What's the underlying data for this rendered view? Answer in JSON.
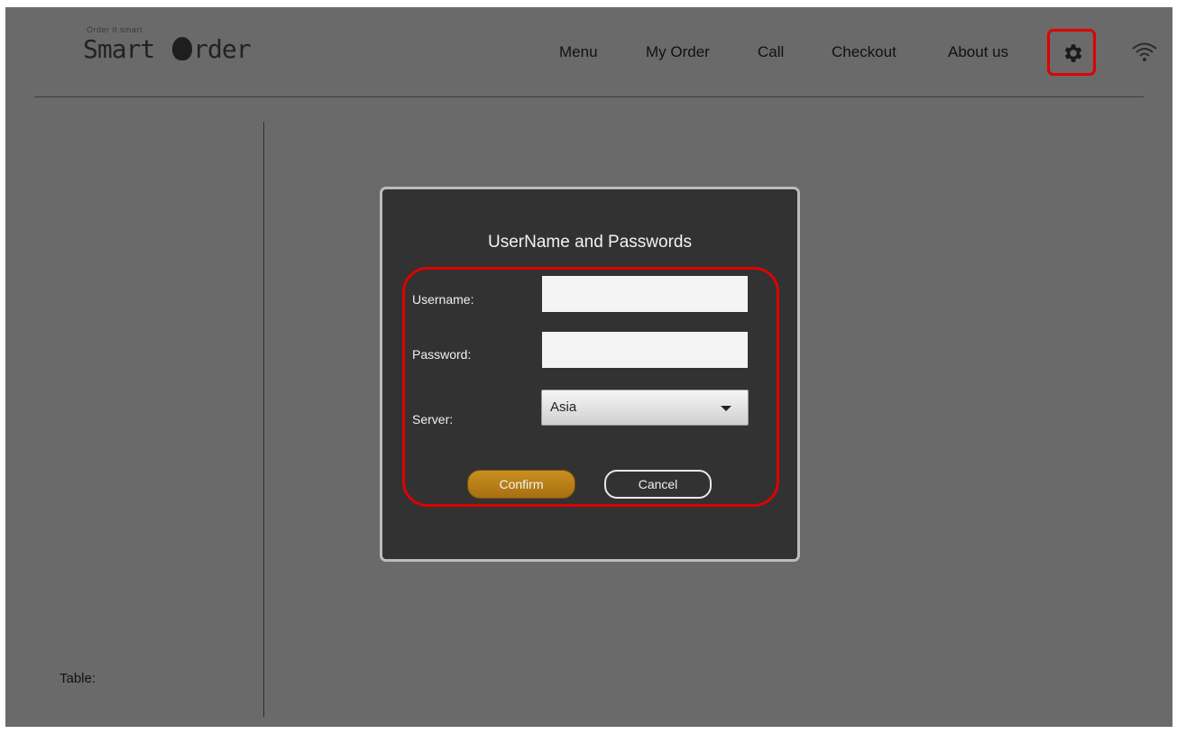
{
  "app": {
    "tagline": "Order it smart",
    "logo_text_prefix": "Smart ",
    "logo_text_suffix": "rder"
  },
  "nav": {
    "items": [
      {
        "label": "Menu"
      },
      {
        "label": "My Order"
      },
      {
        "label": "Call"
      },
      {
        "label": "Checkout"
      },
      {
        "label": "About us"
      }
    ],
    "settings_icon": "gear-icon",
    "wifi_icon": "wifi-icon"
  },
  "sidebar": {
    "table_label": "Table:"
  },
  "dialog": {
    "title": "UserName and Passwords",
    "username_label": "Username:",
    "username_value": "",
    "password_label": "Password:",
    "password_value": "",
    "server_label": "Server:",
    "server_value": "Asia",
    "confirm_label": "Confirm",
    "cancel_label": "Cancel"
  },
  "colors": {
    "overlay_background": "#6a6a6a",
    "dialog_background": "#323232",
    "highlight": "#e00000",
    "confirm_button": "#b47a18"
  }
}
